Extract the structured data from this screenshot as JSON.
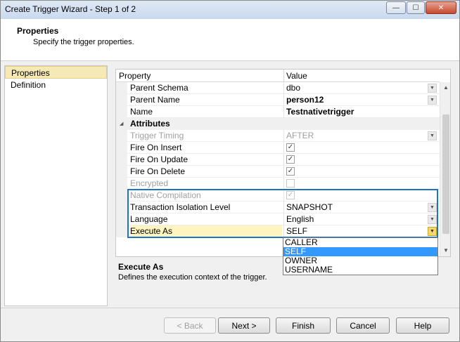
{
  "window": {
    "title": "Create Trigger Wizard - Step 1 of 2",
    "minimize_glyph": "—",
    "maximize_glyph": "☐",
    "close_glyph": "✕"
  },
  "header": {
    "title": "Properties",
    "subtitle": "Specify the trigger properties."
  },
  "nav": {
    "items": [
      {
        "label": "Properties",
        "active": true
      },
      {
        "label": "Definition",
        "active": false
      }
    ]
  },
  "grid": {
    "columns": {
      "property": "Property",
      "value": "Value"
    },
    "rows": [
      {
        "name": "Parent Schema",
        "value": "dbo",
        "kind": "dropdown"
      },
      {
        "name": "Parent Name",
        "value": "person12",
        "kind": "dropdown",
        "bold": true
      },
      {
        "name": "Name",
        "value": "Testnativetrigger",
        "kind": "text",
        "bold": true
      },
      {
        "name": "Attributes",
        "kind": "category"
      },
      {
        "name": "Trigger Timing",
        "value": "AFTER",
        "kind": "dropdown",
        "disabled": true
      },
      {
        "name": "Fire On Insert",
        "kind": "check",
        "checked": true
      },
      {
        "name": "Fire On Update",
        "kind": "check",
        "checked": true
      },
      {
        "name": "Fire On Delete",
        "kind": "check",
        "checked": true
      },
      {
        "name": "Encrypted",
        "kind": "check",
        "checked": false,
        "disabled": true
      },
      {
        "name": "Native Compilation",
        "kind": "check",
        "checked": true,
        "disabled": true
      },
      {
        "name": "Transaction Isolation Level",
        "value": "SNAPSHOT",
        "kind": "dropdown"
      },
      {
        "name": "Language",
        "value": "English",
        "kind": "dropdown"
      },
      {
        "name": "Execute As",
        "value": "SELF",
        "kind": "dropdown",
        "selected": true
      }
    ]
  },
  "execute_as_dropdown": {
    "options": [
      "CALLER",
      "SELF",
      "OWNER",
      "USERNAME"
    ],
    "selected": "SELF"
  },
  "description": {
    "title": "Execute As",
    "text": "Defines the execution context of the trigger."
  },
  "buttons": {
    "back": "< Back",
    "next": "Next >",
    "finish": "Finish",
    "cancel": "Cancel",
    "help": "Help"
  },
  "glyphs": {
    "check": "✓",
    "dropdown": "▼",
    "collapse": "◢",
    "scroll_up": "▲",
    "scroll_down": "▼"
  },
  "colors": {
    "highlight_border": "#1e74c4",
    "selected_option": "#3399ff",
    "nav_active": "#f5e9b8",
    "row_selected": "#fdf4bf"
  }
}
